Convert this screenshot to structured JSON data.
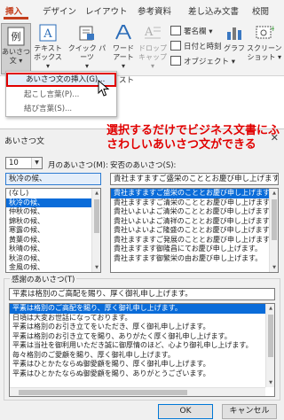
{
  "ribbon": {
    "tabs": [
      {
        "label": "挿入",
        "active": true
      },
      {
        "label": "デザイン"
      },
      {
        "label": "レイアウト"
      },
      {
        "label": "参考資料"
      },
      {
        "label": "差し込み文書"
      },
      {
        "label": "校閲"
      }
    ],
    "buttons": {
      "aisatsu": {
        "glyph": "例",
        "label": "あいさつ\n文 ▾"
      },
      "textbox": {
        "label": "テキスト\nボックス ▾"
      },
      "quickparts": {
        "label": "クイック パーツ\n▾"
      },
      "wordart": {
        "label": "ワード\nアート ▾"
      },
      "dropcap": {
        "label": "ドロップ\nキャップ ▾"
      },
      "graph": {
        "label": "グラフ"
      },
      "screenshot": {
        "label": "スクリーン\nショット ▾"
      }
    },
    "small": {
      "signature": "署名欄 ▾",
      "datetime": "日付と時刻",
      "object": "オブジェクト ▾"
    }
  },
  "menu": {
    "items": [
      {
        "label": "あいさつ文の挿入(G)...",
        "highlight": true
      },
      {
        "label": "起こし言葉(P)..."
      },
      {
        "label": "結び言葉(S)..."
      }
    ],
    "behind": "スト"
  },
  "callout": "選択するだけでビジネス文書にふさわしいあいさつ文ができる",
  "dialog": {
    "title": "あいさつ文",
    "close": "✕",
    "month_value": "10",
    "month_label": "月のあいさつ(M):",
    "anpi_label": "安否のあいさつ(S):",
    "season_input": "秋冷の候、",
    "anpi_input": "貴社ますますご盛栄のこととお慶び申し上げます。",
    "season_list": [
      "(なし)",
      "秋冷の候、",
      "仲秋の候、",
      "錦秋の候、",
      "寒露の候、",
      "黄葉の候、",
      "秋晴の候、",
      "秋涼の候、",
      "金風の候、"
    ],
    "season_selected": 1,
    "anpi_list": [
      "貴社ますますご盛栄のこととお慶び申し上げます。",
      "貴社ますますご清栄のこととお慶び申し上げます。",
      "貴社いよいよご清栄のこととお慶び申し上げます。",
      "貴社いよいよご清祥のこととお慶び申し上げます。",
      "貴社いよいよご隆盛のこととお慶び申し上げます。",
      "貴社ますますご発展のこととお慶び申し上げます。",
      "貴社ますます御隆昌にてお慶び申し上げます。",
      "貴社ますます御繁栄の由お慶び申し上げます。"
    ],
    "anpi_selected": 0,
    "thanks_label": "感謝のあいさつ(T)",
    "thanks_input": "平素は格別のご高配を賜り、厚く御礼申し上げます。",
    "thanks_list": [
      "平素は格別のご高配を賜り、厚く御礼申し上げます。",
      "日頃は大変お世話になっております。",
      "平素は格別のお引き立てをいただき、厚く御礼申し上げます。",
      "平素は格別のお引き立てを賜り、ありがたく厚く御礼申し上げます。",
      "平素は当社を御利用いただき誠に御厚情のほど、心より御礼申し上げます。",
      "毎々格別のご愛顧を賜り、厚く御礼申し上げます。",
      "平素はひとかたならぬ御愛顧を賜り、厚く御礼申し上げます。",
      "平素はひとかたならぬ御愛顧を賜り、ありがとうございます。"
    ],
    "thanks_selected": 0,
    "ok": "OK",
    "cancel": "キャンセル"
  }
}
